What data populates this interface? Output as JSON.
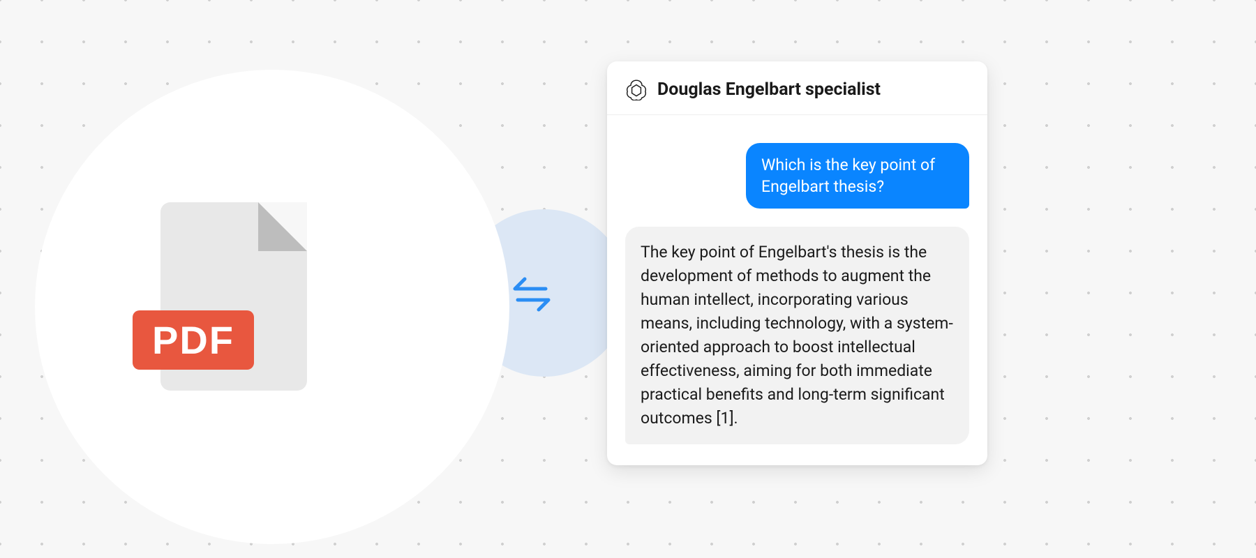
{
  "pdf": {
    "label": "PDF"
  },
  "chat": {
    "title": "Douglas Engelbart specialist",
    "user_message": "Which is the key point of Engelbart thesis?",
    "assistant_message": "The key point of Engelbart's thesis is the development of methods to augment the human intellect, incorporating various means, including technology, with a system-oriented approach to boost intellectual effectiveness, aiming for both immediate practical benefits and long-term significant outcomes [1]."
  },
  "icons": {
    "swap": "bidirectional-arrows",
    "brand": "openai-logo"
  }
}
